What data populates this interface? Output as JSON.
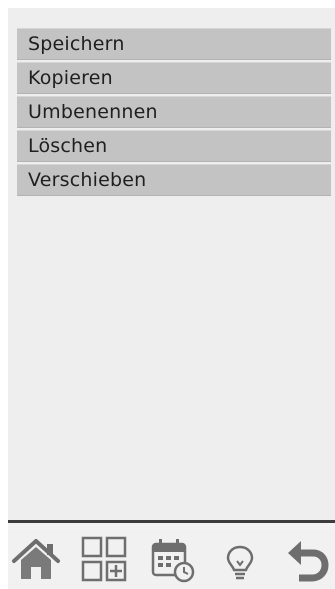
{
  "menu": {
    "items": [
      {
        "label": "Speichern"
      },
      {
        "label": "Kopieren"
      },
      {
        "label": "Umbenennen"
      },
      {
        "label": "Löschen"
      },
      {
        "label": "Verschieben"
      }
    ]
  },
  "toolbar": {
    "icons": [
      "home-icon",
      "grid-add-icon",
      "calendar-clock-icon",
      "lightbulb-icon",
      "undo-icon"
    ],
    "icon_color": "#6e6e6e"
  },
  "colors": {
    "background": "#eeeeee",
    "menu_item": "#c3c3c3",
    "text": "#1f1f1f",
    "separator": "#3d3d3d"
  }
}
